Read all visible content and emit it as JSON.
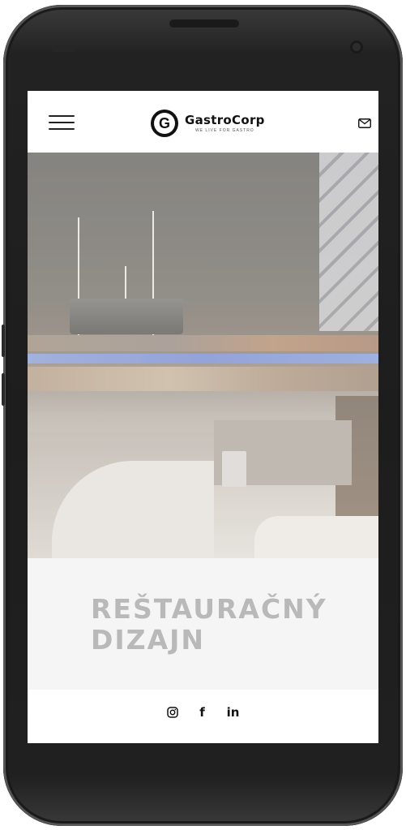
{
  "header": {
    "menu_icon": "hamburger-menu-icon",
    "logo": {
      "mark": "G",
      "name": "GastroCorp",
      "tagline": "WE LIVE FOR GASTRO"
    },
    "mail_icon": "envelope-icon"
  },
  "hero": {
    "image_alt": "restaurant-interior-photo"
  },
  "section": {
    "title_line1": "REŠTAURAČNÝ",
    "title_line2": "DIZAJN"
  },
  "footer": {
    "social": [
      {
        "icon": "instagram-icon"
      },
      {
        "icon": "facebook-icon",
        "glyph": "f"
      },
      {
        "icon": "linkedin-icon",
        "glyph": "in"
      }
    ]
  },
  "colors": {
    "title_text": "#b9b9b9",
    "title_background": "#f5f5f5",
    "icon": "#111111"
  }
}
